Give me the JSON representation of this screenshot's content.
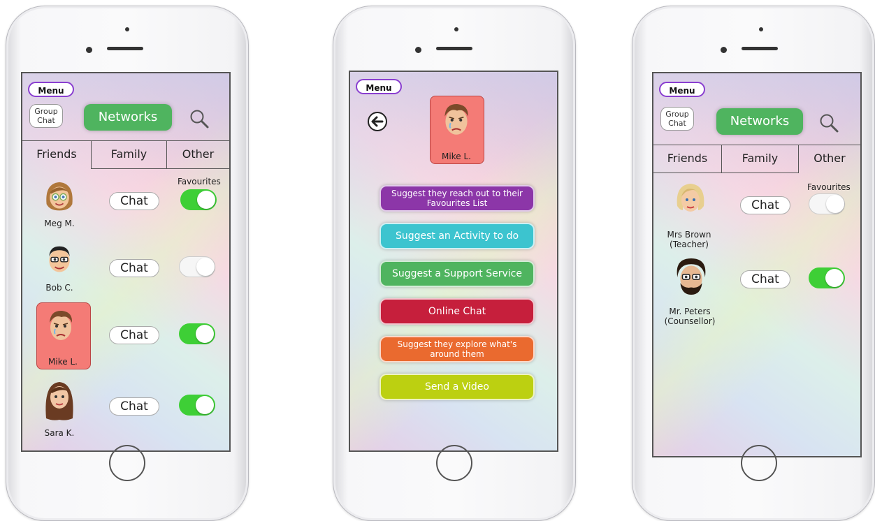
{
  "colors": {
    "menu_border": "#8a3fd0",
    "networks_green": "#4fb45f",
    "toggle_on": "#3ecf36",
    "selected_contact_bg": "#f47b76"
  },
  "phone1": {
    "menu_label": "Menu",
    "group_chat_label": "Group Chat",
    "networks_label": "Networks",
    "search_icon": "search-icon",
    "tabs": [
      "Friends",
      "Family",
      "Other"
    ],
    "favourites_label": "Favourites",
    "contacts": [
      {
        "name": "Meg M.",
        "chat_label": "Chat",
        "favourite": true
      },
      {
        "name": "Bob C.",
        "chat_label": "Chat",
        "favourite": false
      },
      {
        "name": "Mike L.",
        "chat_label": "Chat",
        "favourite": true
      },
      {
        "name": "Sara K.",
        "chat_label": "Chat",
        "favourite": true
      }
    ]
  },
  "phone2": {
    "menu_label": "Menu",
    "back_icon": "back-arrow-icon",
    "contact_name": "Mike L.",
    "actions": [
      {
        "label": "Suggest they reach out to their Favourites List",
        "color": "#8c36a8"
      },
      {
        "label": "Suggest an Activity to do",
        "color": "#3cc4cf"
      },
      {
        "label": "Suggest a Support Service",
        "color": "#4fb45f"
      },
      {
        "label": "Online Chat",
        "color": "#c61f3c"
      },
      {
        "label": "Suggest they explore what's around them",
        "color": "#ea6a2f"
      },
      {
        "label": "Send a Video",
        "color": "#bcd011"
      }
    ]
  },
  "phone3": {
    "menu_label": "Menu",
    "group_chat_label": "Group Chat",
    "networks_label": "Networks",
    "search_icon": "search-icon",
    "tabs": [
      "Friends",
      "Family",
      "Other"
    ],
    "favourites_label": "Favourites",
    "contacts": [
      {
        "name": "Mrs Brown (Teacher)",
        "chat_label": "Chat",
        "favourite": false
      },
      {
        "name": "Mr. Peters (Counsellor)",
        "chat_label": "Chat",
        "favourite": true
      }
    ]
  }
}
